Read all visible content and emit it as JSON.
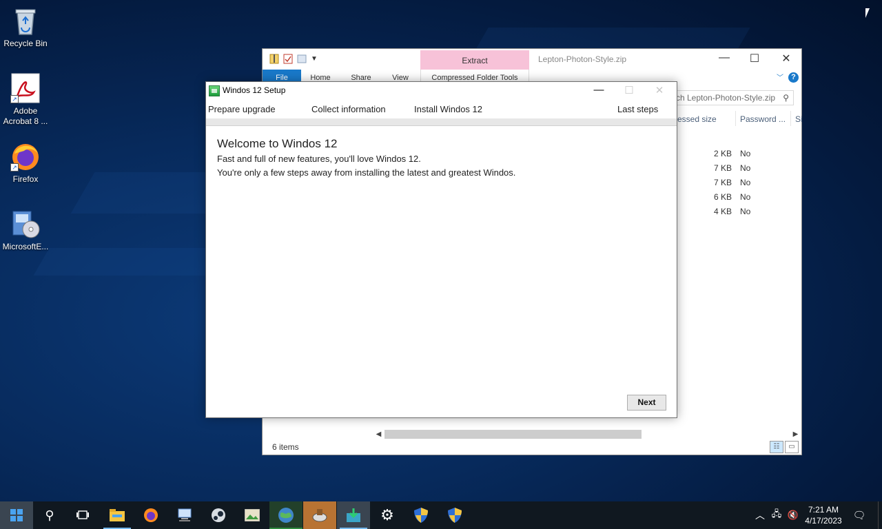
{
  "desktop": {
    "icons": [
      {
        "label": "Recycle Bin",
        "icon": "recycle-bin-icon"
      },
      {
        "label": "Adobe\nAcrobat 8 ...",
        "icon": "acrobat-icon"
      },
      {
        "label": "Firefox",
        "icon": "firefox-icon"
      },
      {
        "label": "MicrosoftE...",
        "icon": "microsoft-edge-installer-icon"
      }
    ]
  },
  "explorer": {
    "title": "Lepton-Photon-Style.zip",
    "contextual_tab": "Extract",
    "contextual_group": "Compressed Folder Tools",
    "tabs": {
      "file": "File",
      "home": "Home",
      "share": "Share",
      "view": "View"
    },
    "search_placeholder": "ch Lepton-Photon-Style.zip",
    "columns": {
      "compressed_size": "essed size",
      "password": "Password ...",
      "size": "Si"
    },
    "rows": [
      {
        "compressed": "2 KB",
        "password": "No"
      },
      {
        "compressed": "7 KB",
        "password": "No"
      },
      {
        "compressed": "7 KB",
        "password": "No"
      },
      {
        "compressed": "6 KB",
        "password": "No"
      },
      {
        "compressed": "4 KB",
        "password": "No"
      }
    ],
    "status": "6 items"
  },
  "setup": {
    "title": "Windos 12 Setup",
    "steps": {
      "prepare": "Prepare upgrade",
      "collect": "Collect information",
      "install": "Install Windos 12",
      "last": "Last steps"
    },
    "welcome_title": "Welcome to Windos 12",
    "line1": "Fast and full of new features, you'll love Windos 12.",
    "line2": "You're only a few steps away from installing the latest and greatest Windos.",
    "next_label": "Next"
  },
  "taskbar": {
    "apps": [
      "file-explorer-icon",
      "firefox-icon",
      "network-computer-icon",
      "steam-icon",
      "photo-viewer-icon",
      "globe-icon",
      "disk-utility-icon",
      "installer-icon",
      "settings-icon",
      "shield-icon",
      "shield-icon"
    ],
    "clock_time": "7:21 AM",
    "clock_date": "4/17/2023"
  },
  "colors": {
    "accent": "#1979ca",
    "extract_tab": "#f7c2d8",
    "taskbar": "#101820"
  }
}
